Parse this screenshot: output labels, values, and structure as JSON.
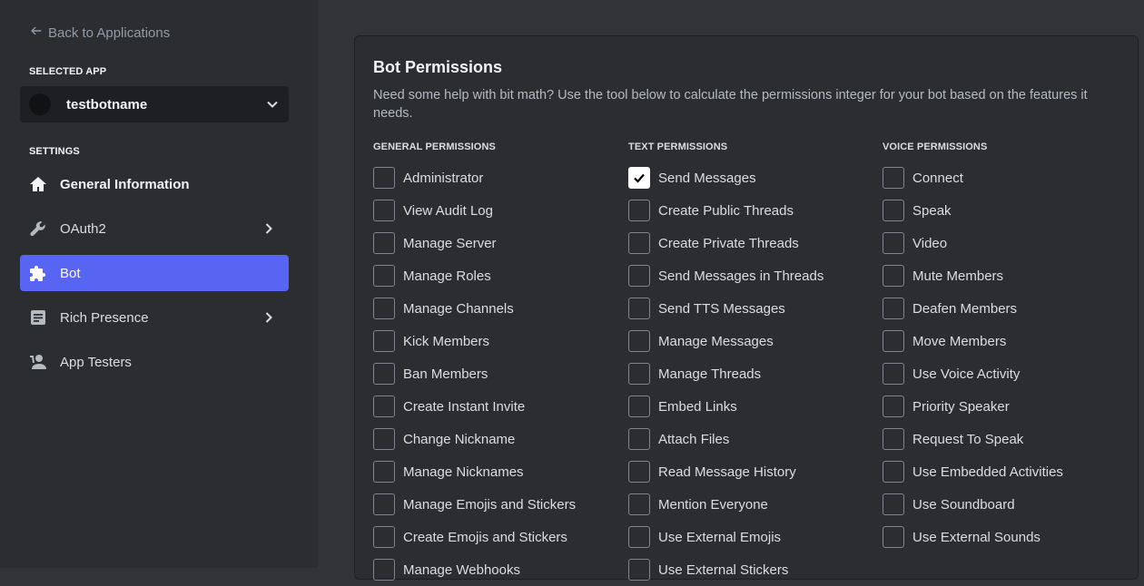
{
  "sidebar": {
    "back_label": "Back to Applications",
    "selected_app_title": "SELECTED APP",
    "app_name": "testbotname",
    "settings_title": "SETTINGS",
    "items": [
      {
        "label": "General Information"
      },
      {
        "label": "OAuth2"
      },
      {
        "label": "Bot"
      },
      {
        "label": "Rich Presence"
      },
      {
        "label": "App Testers"
      }
    ]
  },
  "permissions": {
    "title": "Bot Permissions",
    "description": "Need some help with bit math? Use the tool below to calculate the permissions integer for your bot based on the features it needs.",
    "general": {
      "header": "GENERAL PERMISSIONS",
      "items": [
        "Administrator",
        "View Audit Log",
        "Manage Server",
        "Manage Roles",
        "Manage Channels",
        "Kick Members",
        "Ban Members",
        "Create Instant Invite",
        "Change Nickname",
        "Manage Nicknames",
        "Manage Emojis and Stickers",
        "Create Emojis and Stickers",
        "Manage Webhooks"
      ]
    },
    "text": {
      "header": "TEXT PERMISSIONS",
      "items": [
        "Send Messages",
        "Create Public Threads",
        "Create Private Threads",
        "Send Messages in Threads",
        "Send TTS Messages",
        "Manage Messages",
        "Manage Threads",
        "Embed Links",
        "Attach Files",
        "Read Message History",
        "Mention Everyone",
        "Use External Emojis",
        "Use External Stickers"
      ],
      "checked": [
        "Send Messages"
      ]
    },
    "voice": {
      "header": "VOICE PERMISSIONS",
      "items": [
        "Connect",
        "Speak",
        "Video",
        "Mute Members",
        "Deafen Members",
        "Move Members",
        "Use Voice Activity",
        "Priority Speaker",
        "Request To Speak",
        "Use Embedded Activities",
        "Use Soundboard",
        "Use External Sounds"
      ]
    }
  },
  "colors": {
    "accent": "#5865f2",
    "sidebar_bg": "#2b2d31",
    "main_bg": "#313338"
  }
}
